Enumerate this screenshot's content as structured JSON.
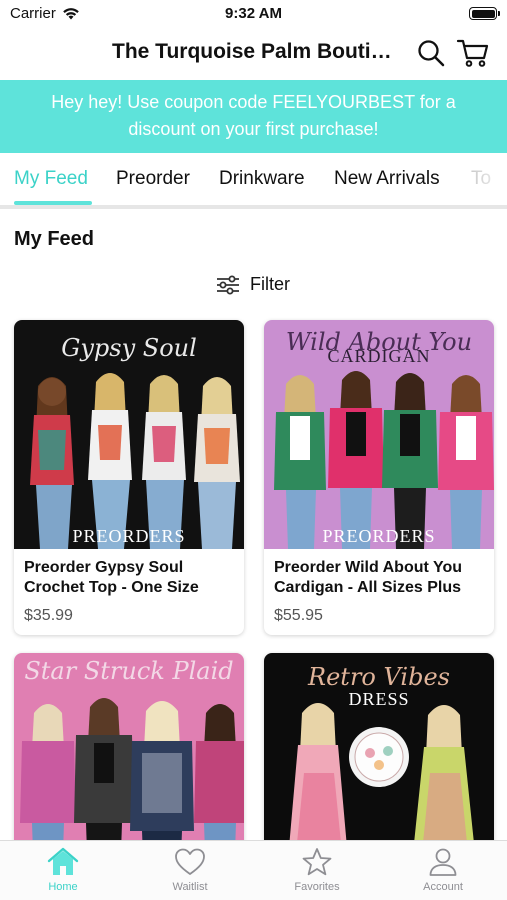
{
  "status_bar": {
    "carrier": "Carrier",
    "time": "9:32 AM"
  },
  "header": {
    "title": "The Turquoise Palm Boutique"
  },
  "banner": {
    "text": "Hey hey! Use coupon code FEELYOURBEST for a discount on your first purchase!"
  },
  "tabs": [
    {
      "label": "My Feed",
      "active": true
    },
    {
      "label": "Preorder"
    },
    {
      "label": "Drinkware"
    },
    {
      "label": "New Arrivals"
    },
    {
      "label": "To"
    }
  ],
  "feed": {
    "title": "My Feed",
    "filter_label": "Filter"
  },
  "products": [
    {
      "name": "Preorder Gypsy Soul Crochet Top - One Size",
      "price": "$35.99",
      "image_script": "Gypsy Soul",
      "image_caps": "PREORDERS",
      "image_bg": "#111111"
    },
    {
      "name": "Preorder Wild About You Cardigan - All Sizes Plus",
      "price": "$55.95",
      "image_script": "Wild About You",
      "image_caps_top": "CARDIGAN",
      "image_caps": "PREORDERS",
      "image_bg": "#c98fd0"
    },
    {
      "name": "",
      "price": "",
      "image_script": "Star Struck Plaid",
      "image_bg": "#e07fb2"
    },
    {
      "name": "",
      "price": "",
      "image_script": "Retro Vibes",
      "image_caps_top": "DRESS",
      "image_bg": "#0c0c0c"
    }
  ],
  "bottom_nav": [
    {
      "label": "Home",
      "icon": "home-icon",
      "active": true
    },
    {
      "label": "Waitlist",
      "icon": "heart-icon"
    },
    {
      "label": "Favorites",
      "icon": "star-icon"
    },
    {
      "label": "Account",
      "icon": "person-icon"
    }
  ],
  "colors": {
    "accent": "#5ee3da",
    "accent_text": "#3bd2c8",
    "banner_text": "#ffffff"
  }
}
